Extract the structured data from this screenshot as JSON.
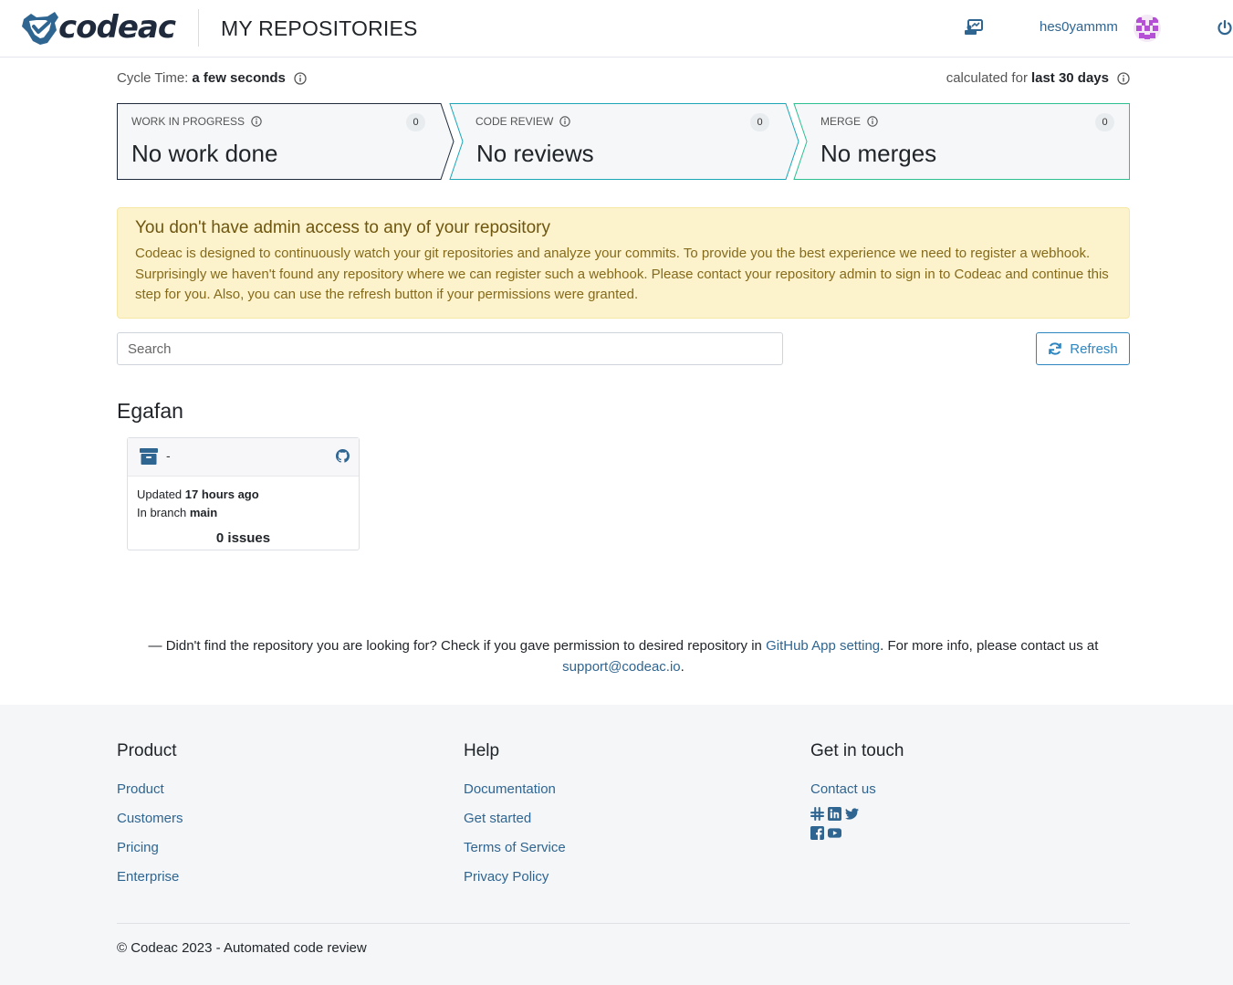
{
  "header": {
    "logo_text": "codeac",
    "title": "MY REPOSITORIES",
    "username": "hes0yammm",
    "icons": [
      "switch-board-icon",
      "avatar",
      "power-icon"
    ]
  },
  "cycle": {
    "label": "Cycle Time:",
    "value": "a few seconds",
    "calc_prefix": "calculated for",
    "calc_value": "last 30 days"
  },
  "stages": [
    {
      "label": "WORK IN PROGRESS",
      "count": "0",
      "value": "No work done",
      "color": "#1f2b3d"
    },
    {
      "label": "CODE REVIEW",
      "count": "0",
      "value": "No reviews",
      "color": "#1aa6b7"
    },
    {
      "label": "MERGE",
      "count": "0",
      "value": "No merges",
      "color": "#2dbf91"
    }
  ],
  "alert": {
    "title": "You don't have admin access to any of your repository",
    "text": "Codeac is designed to continuously watch your git repositories and analyze your commits. To provide you the best experience we need to register a webhook. Surprisingly we haven't found any repository where we can register such a webhook. Please contact your repository admin to sign in to Codeac and continue this step for you. Also, you can use the refresh button if your permissions were granted."
  },
  "search": {
    "placeholder": "Search"
  },
  "refresh_label": "Refresh",
  "group": {
    "name": "Egafan",
    "repos": [
      {
        "name": "-",
        "updated_prefix": "Updated",
        "updated": "17 hours ago",
        "branch_prefix": "In branch",
        "branch": "main",
        "issues": "0 issues"
      }
    ]
  },
  "note": {
    "prefix": "— Didn't find the repository you are looking for? Check if you gave permission to desired repository in",
    "link": "GitHub App setting",
    "middle": ". For more info, please contact us at",
    "email": "support@codeac.io",
    "suffix": "."
  },
  "footer": {
    "product": {
      "title": "Product",
      "links": [
        "Product",
        "Customers",
        "Pricing",
        "Enterprise"
      ]
    },
    "help": {
      "title": "Help",
      "links": [
        "Documentation",
        "Get started",
        "Terms of Service",
        "Privacy Policy"
      ]
    },
    "contact": {
      "title": "Get in touch",
      "link": "Contact us",
      "social": [
        "slack-icon",
        "linkedin-icon",
        "twitter-icon",
        "facebook-icon",
        "youtube-icon"
      ]
    },
    "copyright": "© Codeac 2023 - Automated code review"
  }
}
